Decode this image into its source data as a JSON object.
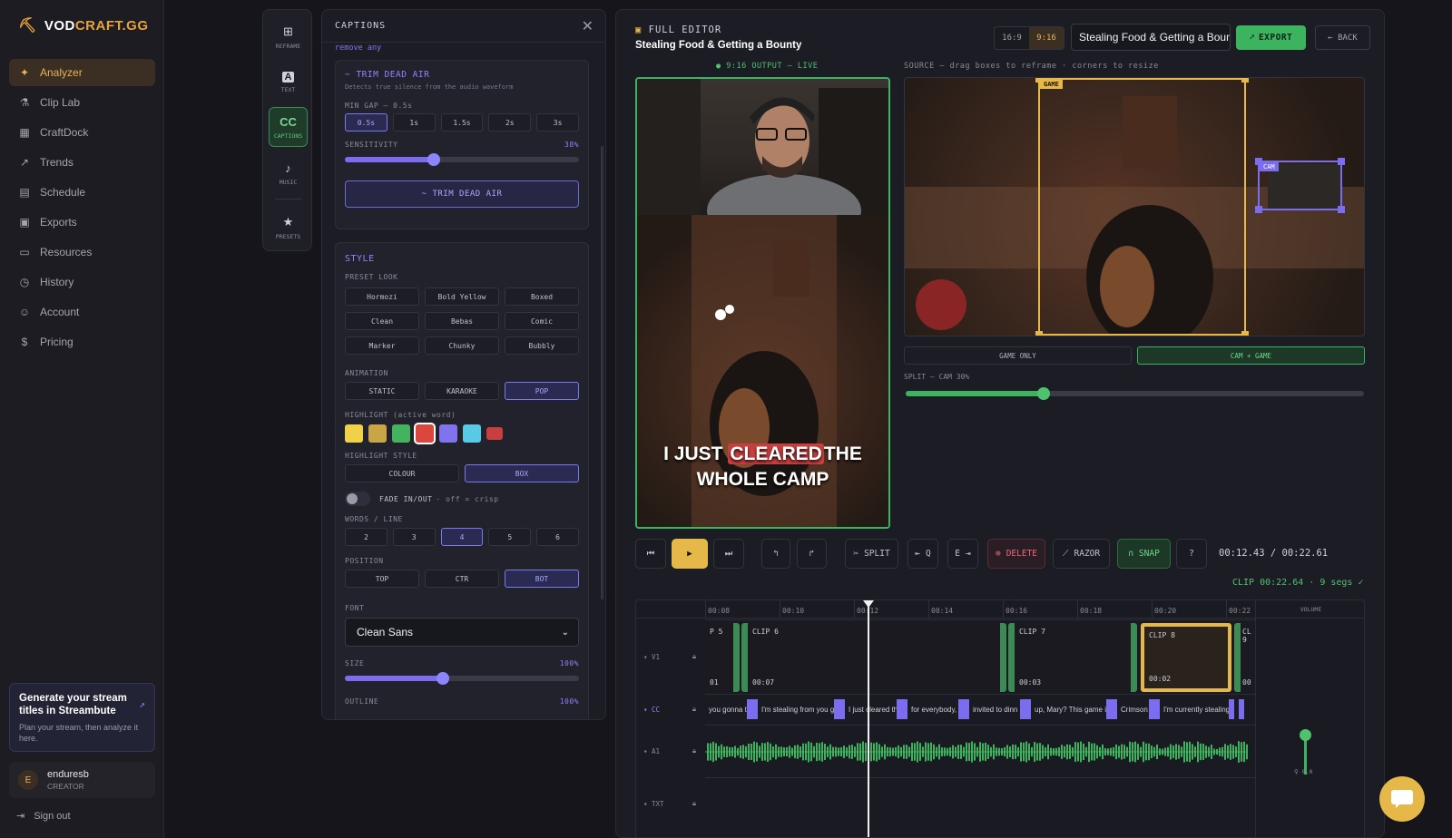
{
  "app": {
    "logo_text_1": "VOD",
    "logo_text_2": "CRAFT.GG"
  },
  "sidebar": {
    "items": [
      {
        "label": "Analyzer",
        "icon": "sparkle-icon"
      },
      {
        "label": "Clip Lab",
        "icon": "flask-icon"
      },
      {
        "label": "CraftDock",
        "icon": "grid-icon"
      },
      {
        "label": "Trends",
        "icon": "trend-icon"
      },
      {
        "label": "Schedule",
        "icon": "calendar-icon"
      },
      {
        "label": "Exports",
        "icon": "film-icon"
      },
      {
        "label": "Resources",
        "icon": "folder-icon"
      },
      {
        "label": "History",
        "icon": "clock-icon"
      },
      {
        "label": "Account",
        "icon": "user-icon"
      },
      {
        "label": "Pricing",
        "icon": "dollar-icon"
      }
    ],
    "promo": {
      "title": "Generate your stream titles in Streambute",
      "desc": "Plan your stream, then analyze it here."
    },
    "user": {
      "initial": "E",
      "name": "enduresb",
      "role": "CREATOR"
    },
    "signout": "Sign out"
  },
  "rail": {
    "tools": [
      {
        "glyph": "⊞",
        "label": "REFRAME"
      },
      {
        "glyph": "A",
        "label": "TEXT"
      },
      {
        "glyph": "CC",
        "label": "CAPTIONS"
      },
      {
        "glyph": "♪",
        "label": "MUSIC"
      },
      {
        "glyph": "★",
        "label": "PRESETS"
      }
    ]
  },
  "captions": {
    "title": "CAPTIONS",
    "top_hint": "remove any",
    "trim": {
      "title": "~ TRIM DEAD AIR",
      "desc": "Detects true silence from the audio waveform",
      "min_gap_label": "MIN GAP — 0.5s",
      "gaps": [
        "0.5s",
        "1s",
        "1.5s",
        "2s",
        "3s"
      ],
      "sensitivity_label": "SENSITIVITY",
      "sensitivity_value": "38%",
      "sensitivity": 0.38,
      "button": "~ TRIM DEAD AIR"
    },
    "style": {
      "title": "STYLE",
      "preset_label": "PRESET LOOK",
      "presets": [
        "Hormozi",
        "Bold Yellow",
        "Boxed",
        "Clean",
        "Bebas",
        "Comic",
        "Marker",
        "Chunky",
        "Bubbly"
      ],
      "animation_label": "ANIMATION",
      "animations": [
        "STATIC",
        "KARAOKE",
        "POP"
      ],
      "highlight_label": "HIGHLIGHT (active word)",
      "highlight_colors": [
        "#f2d14a",
        "#c8a545",
        "#44b35d",
        "#d9473f",
        "#7f74ee",
        "#59c9e6",
        "#c93f3f"
      ],
      "highlight_style_label": "HIGHLIGHT STYLE",
      "highlight_styles": [
        "COLOUR",
        "BOX"
      ],
      "fade_label": "FADE IN/OUT",
      "fade_hint": "· off = crisp",
      "words_label": "WORDS / LINE",
      "words": [
        "2",
        "3",
        "4",
        "5",
        "6"
      ],
      "position_label": "POSITION",
      "positions": [
        "TOP",
        "CTR",
        "BOT"
      ],
      "font_label": "FONT",
      "font_value": "Clean Sans",
      "size_label": "SIZE",
      "size_value": "100%",
      "size": 0.42,
      "outline_label": "OUTLINE",
      "outline_value": "100%"
    }
  },
  "editor": {
    "title": "FULL EDITOR",
    "subtitle": "Stealing Food & Getting a Bounty",
    "ratios": [
      "16:9",
      "9:16"
    ],
    "title_input": "Stealing Food & Getting a Bounty",
    "export": "EXPORT",
    "back": "← BACK",
    "output_label": "● 9:16 OUTPUT — LIVE",
    "source_label": "SOURCE — drag boxes to reframe · corners to resize",
    "caption_pre": "I JUST",
    "caption_hl": "CLEARED",
    "caption_post": "THE",
    "caption_line2": "WHOLE CAMP",
    "game_tag": "GAME",
    "cam_tag": "CAM",
    "layouts": [
      "GAME ONLY",
      "CAM + GAME"
    ],
    "split_label": "SPLIT — CAM 30%",
    "split": 0.3,
    "toolbar": {
      "split": "SPLIT",
      "q": "Q",
      "e": "E",
      "delete": "DELETE",
      "razor": "RAZOR",
      "snap": "SNAP",
      "help": "?"
    },
    "timecode": "00:12.43 / 00:22.61",
    "clip_summary": "CLIP 00:22.64 · 9 segs ✓",
    "ruler": [
      "00:08",
      "00:10",
      "00:12",
      "00:14",
      "00:16",
      "00:18",
      "00:20",
      "00:22"
    ],
    "volume_label": "VOLUME",
    "volume_value": "0.0",
    "tracks": [
      "V1",
      "CC",
      "A1",
      "TXT"
    ],
    "clips": [
      {
        "name": "P 5",
        "dur": "01"
      },
      {
        "name": "CLIP 6",
        "dur": "00:07"
      },
      {
        "name": "CLIP 7",
        "dur": "00:03"
      },
      {
        "name": "CLIP 8",
        "dur": "00:02"
      },
      {
        "name": "CL 9",
        "dur": "00"
      }
    ],
    "captions_track": [
      "you gonna te",
      "I'm stealing from you gu",
      "I just cleared the",
      "for everybody, a",
      "invited to dinn",
      "up, Mary? This game is",
      "Crimson D",
      "I'm currently stealing"
    ]
  }
}
